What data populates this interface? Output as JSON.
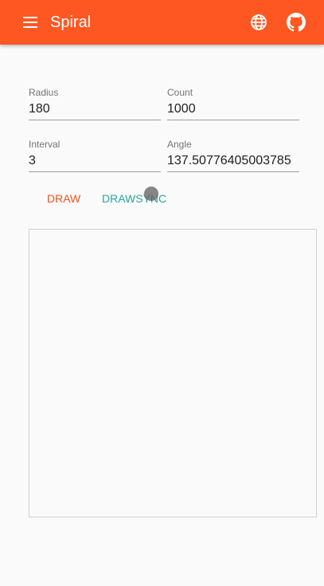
{
  "appbar": {
    "title": "Spiral",
    "icons": {
      "menu": "menu-icon",
      "language": "globe-icon",
      "source": "github-icon"
    }
  },
  "form": {
    "radius": {
      "label": "Radius",
      "value": "180"
    },
    "count": {
      "label": "Count",
      "value": "1000"
    },
    "interval": {
      "label": "Interval",
      "value": "3"
    },
    "angle": {
      "label": "Angle",
      "value": "137.50776405003785"
    }
  },
  "actions": {
    "draw_label": "DRAW",
    "drawsync_label": "DRAWSYNC"
  },
  "colors": {
    "primary": "#ff5722",
    "accent": "#26a69a",
    "draw_button": "#f4511e",
    "background": "#fafafa"
  }
}
